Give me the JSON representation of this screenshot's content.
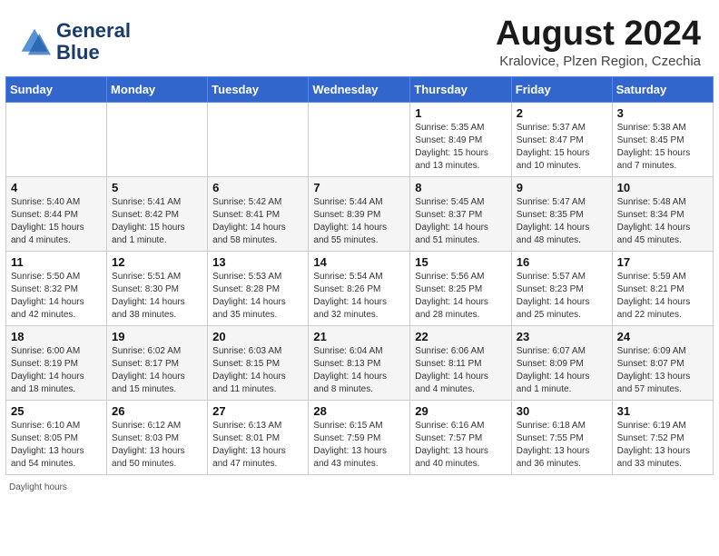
{
  "header": {
    "logo_line1": "General",
    "logo_line2": "Blue",
    "month_title": "August 2024",
    "location": "Kralovice, Plzen Region, Czechia"
  },
  "weekdays": [
    "Sunday",
    "Monday",
    "Tuesday",
    "Wednesday",
    "Thursday",
    "Friday",
    "Saturday"
  ],
  "footer": {
    "daylight_label": "Daylight hours"
  },
  "weeks": [
    {
      "days": [
        {
          "num": "",
          "info": ""
        },
        {
          "num": "",
          "info": ""
        },
        {
          "num": "",
          "info": ""
        },
        {
          "num": "",
          "info": ""
        },
        {
          "num": "1",
          "info": "Sunrise: 5:35 AM\nSunset: 8:49 PM\nDaylight: 15 hours\nand 13 minutes."
        },
        {
          "num": "2",
          "info": "Sunrise: 5:37 AM\nSunset: 8:47 PM\nDaylight: 15 hours\nand 10 minutes."
        },
        {
          "num": "3",
          "info": "Sunrise: 5:38 AM\nSunset: 8:45 PM\nDaylight: 15 hours\nand 7 minutes."
        }
      ]
    },
    {
      "days": [
        {
          "num": "4",
          "info": "Sunrise: 5:40 AM\nSunset: 8:44 PM\nDaylight: 15 hours\nand 4 minutes."
        },
        {
          "num": "5",
          "info": "Sunrise: 5:41 AM\nSunset: 8:42 PM\nDaylight: 15 hours\nand 1 minute."
        },
        {
          "num": "6",
          "info": "Sunrise: 5:42 AM\nSunset: 8:41 PM\nDaylight: 14 hours\nand 58 minutes."
        },
        {
          "num": "7",
          "info": "Sunrise: 5:44 AM\nSunset: 8:39 PM\nDaylight: 14 hours\nand 55 minutes."
        },
        {
          "num": "8",
          "info": "Sunrise: 5:45 AM\nSunset: 8:37 PM\nDaylight: 14 hours\nand 51 minutes."
        },
        {
          "num": "9",
          "info": "Sunrise: 5:47 AM\nSunset: 8:35 PM\nDaylight: 14 hours\nand 48 minutes."
        },
        {
          "num": "10",
          "info": "Sunrise: 5:48 AM\nSunset: 8:34 PM\nDaylight: 14 hours\nand 45 minutes."
        }
      ]
    },
    {
      "days": [
        {
          "num": "11",
          "info": "Sunrise: 5:50 AM\nSunset: 8:32 PM\nDaylight: 14 hours\nand 42 minutes."
        },
        {
          "num": "12",
          "info": "Sunrise: 5:51 AM\nSunset: 8:30 PM\nDaylight: 14 hours\nand 38 minutes."
        },
        {
          "num": "13",
          "info": "Sunrise: 5:53 AM\nSunset: 8:28 PM\nDaylight: 14 hours\nand 35 minutes."
        },
        {
          "num": "14",
          "info": "Sunrise: 5:54 AM\nSunset: 8:26 PM\nDaylight: 14 hours\nand 32 minutes."
        },
        {
          "num": "15",
          "info": "Sunrise: 5:56 AM\nSunset: 8:25 PM\nDaylight: 14 hours\nand 28 minutes."
        },
        {
          "num": "16",
          "info": "Sunrise: 5:57 AM\nSunset: 8:23 PM\nDaylight: 14 hours\nand 25 minutes."
        },
        {
          "num": "17",
          "info": "Sunrise: 5:59 AM\nSunset: 8:21 PM\nDaylight: 14 hours\nand 22 minutes."
        }
      ]
    },
    {
      "days": [
        {
          "num": "18",
          "info": "Sunrise: 6:00 AM\nSunset: 8:19 PM\nDaylight: 14 hours\nand 18 minutes."
        },
        {
          "num": "19",
          "info": "Sunrise: 6:02 AM\nSunset: 8:17 PM\nDaylight: 14 hours\nand 15 minutes."
        },
        {
          "num": "20",
          "info": "Sunrise: 6:03 AM\nSunset: 8:15 PM\nDaylight: 14 hours\nand 11 minutes."
        },
        {
          "num": "21",
          "info": "Sunrise: 6:04 AM\nSunset: 8:13 PM\nDaylight: 14 hours\nand 8 minutes."
        },
        {
          "num": "22",
          "info": "Sunrise: 6:06 AM\nSunset: 8:11 PM\nDaylight: 14 hours\nand 4 minutes."
        },
        {
          "num": "23",
          "info": "Sunrise: 6:07 AM\nSunset: 8:09 PM\nDaylight: 14 hours\nand 1 minute."
        },
        {
          "num": "24",
          "info": "Sunrise: 6:09 AM\nSunset: 8:07 PM\nDaylight: 13 hours\nand 57 minutes."
        }
      ]
    },
    {
      "days": [
        {
          "num": "25",
          "info": "Sunrise: 6:10 AM\nSunset: 8:05 PM\nDaylight: 13 hours\nand 54 minutes."
        },
        {
          "num": "26",
          "info": "Sunrise: 6:12 AM\nSunset: 8:03 PM\nDaylight: 13 hours\nand 50 minutes."
        },
        {
          "num": "27",
          "info": "Sunrise: 6:13 AM\nSunset: 8:01 PM\nDaylight: 13 hours\nand 47 minutes."
        },
        {
          "num": "28",
          "info": "Sunrise: 6:15 AM\nSunset: 7:59 PM\nDaylight: 13 hours\nand 43 minutes."
        },
        {
          "num": "29",
          "info": "Sunrise: 6:16 AM\nSunset: 7:57 PM\nDaylight: 13 hours\nand 40 minutes."
        },
        {
          "num": "30",
          "info": "Sunrise: 6:18 AM\nSunset: 7:55 PM\nDaylight: 13 hours\nand 36 minutes."
        },
        {
          "num": "31",
          "info": "Sunrise: 6:19 AM\nSunset: 7:52 PM\nDaylight: 13 hours\nand 33 minutes."
        }
      ]
    }
  ]
}
